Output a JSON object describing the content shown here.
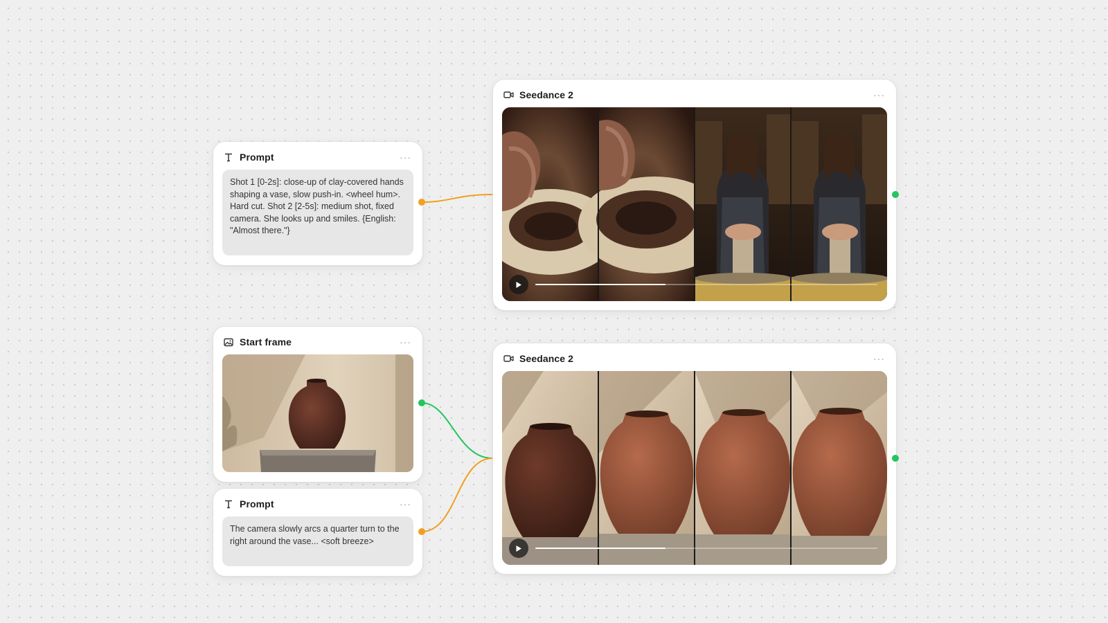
{
  "colors": {
    "prompt_wire": "#f0a020",
    "image_wire": "#22c55e",
    "output_port": "#22c55e"
  },
  "nodes": {
    "prompt_1": {
      "title": "Prompt",
      "icon": "text-icon",
      "text": "Shot 1 [0-2s]: close-up of clay-covered hands shaping a vase, slow push-in. <wheel hum>. Hard cut. Shot 2 [2-5s]: medium shot, fixed camera. She looks up and smiles. {English: \"Almost there.\"}"
    },
    "video_1": {
      "title": "Seedance 2",
      "icon": "video-camera-icon",
      "progress": 0.38
    },
    "start_frame": {
      "title": "Start frame",
      "icon": "image-icon"
    },
    "prompt_2": {
      "title": "Prompt",
      "icon": "text-icon",
      "text": "The camera slowly arcs a quarter turn to the right around the vase... <soft breeze>"
    },
    "video_2": {
      "title": "Seedance 2",
      "icon": "video-camera-icon",
      "progress": 0.38
    }
  }
}
